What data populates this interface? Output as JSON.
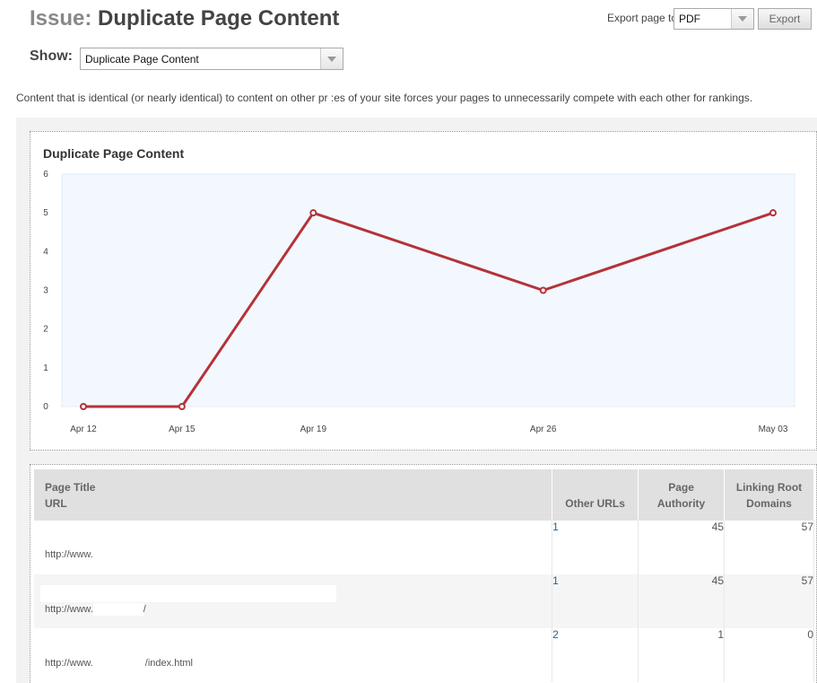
{
  "header": {
    "issue_label": "Issue:",
    "issue_title": "Duplicate Page Content",
    "export_label": "Export page to",
    "export_format": "PDF",
    "export_button": "Export"
  },
  "filter": {
    "show_label": "Show:",
    "show_value": "Duplicate Page Content"
  },
  "description": "Content that is identical (or nearly identical) to content on other pr :es of your site forces your pages to unnecessarily compete with each other for rankings.",
  "chart_data": {
    "type": "line",
    "title": "Duplicate Page Content",
    "xlabel": "",
    "ylabel": "",
    "x": [
      "Apr 12",
      "Apr 15",
      "Apr 19",
      "Apr 26",
      "May 03"
    ],
    "x_days": [
      0,
      3,
      7,
      14,
      21
    ],
    "values": [
      0,
      0,
      5,
      3,
      5
    ],
    "ylim": [
      0,
      6
    ],
    "yticks": [
      "0",
      "1",
      "2",
      "3",
      "4",
      "5",
      "6"
    ],
    "line_color": "#b5323a",
    "plot_bg": "#f2f8fd",
    "grid": false
  },
  "table": {
    "headers": {
      "title_line1": "Page Title",
      "title_line2": "URL",
      "other_urls": "Other URLs",
      "page_authority_1": "Page",
      "page_authority_2": "Authority",
      "linking_1": "Linking Root",
      "linking_2": "Domains"
    },
    "rows": [
      {
        "title": "",
        "url": "http://www.",
        "url_suffix": "",
        "other_urls": "1",
        "page_authority": "45",
        "linking_root_domains": "57"
      },
      {
        "title": "",
        "url": "http://www.",
        "url_suffix": "/",
        "other_urls": "1",
        "page_authority": "45",
        "linking_root_domains": "57"
      },
      {
        "title": "",
        "url": "http://www.",
        "url_suffix": "/index.html",
        "other_urls": "2",
        "page_authority": "1",
        "linking_root_domains": "0"
      }
    ]
  }
}
